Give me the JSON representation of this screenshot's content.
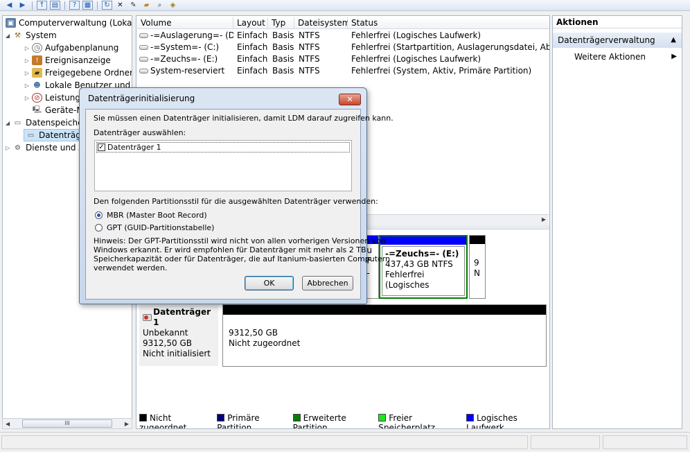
{
  "toolbar": {
    "icons": [
      "back-icon",
      "forward-icon",
      "up-folder-icon",
      "show-hide-tree-icon",
      "help-icon",
      "properties-icon",
      "refresh-icon",
      "delete-icon",
      "properties-sheet-icon",
      "open-icon",
      "search-icon",
      "rescan-icon"
    ]
  },
  "tree": {
    "items": [
      {
        "label": "Computerverwaltung (Lokal)"
      },
      {
        "label": "System"
      },
      {
        "label": "Aufgabenplanung"
      },
      {
        "label": "Ereignisanzeige"
      },
      {
        "label": "Freigegebene Ordner"
      },
      {
        "label": "Lokale Benutzer und Gr"
      },
      {
        "label": "Leistung"
      },
      {
        "label": "Geräte-M"
      },
      {
        "label": "Datenspeiche"
      },
      {
        "label": "Datenträg"
      },
      {
        "label": "Dienste und A"
      }
    ],
    "scroll_thumb": "III"
  },
  "volumes": {
    "columns": [
      "Volume",
      "Layout",
      "Typ",
      "Dateisystem",
      "Status"
    ],
    "rows": [
      {
        "volume": "-=Auslagerung=- (D:)",
        "layout": "Einfach",
        "typ": "Basis",
        "fs": "NTFS",
        "status": "Fehlerfrei (Logisches Laufwerk)"
      },
      {
        "volume": "-=System=- (C:)",
        "layout": "Einfach",
        "typ": "Basis",
        "fs": "NTFS",
        "status": "Fehlerfrei (Startpartition, Auslagerungsdatei, Absturzab"
      },
      {
        "volume": "-=Zeuchs=- (E:)",
        "layout": "Einfach",
        "typ": "Basis",
        "fs": "NTFS",
        "status": "Fehlerfrei (Logisches Laufwerk)"
      },
      {
        "volume": "System-reserviert",
        "layout": "Einfach",
        "typ": "Basis",
        "fs": "NTFS",
        "status": "Fehlerfrei (System, Aktiv, Primäre Partition)"
      }
    ]
  },
  "disk0": {
    "part_a": {
      "lines": [
        "eu",
        "TF",
        "(L"
      ]
    },
    "part_e": {
      "name": "-=Zeuchs=-  (E:)",
      "size": "437,43 GB NTFS",
      "status": "Fehlerfrei (Logisches"
    },
    "part_last": {
      "lines": [
        "9",
        "N"
      ]
    }
  },
  "disk1": {
    "name": "Datenträger 1",
    "type": "Unbekannt",
    "size": "9312,50 GB",
    "state": "Nicht initialisiert",
    "unalloc_size": "9312,50 GB",
    "unalloc_label": "Nicht zugeordnet"
  },
  "legend": [
    {
      "label": "Nicht zugeordnet",
      "color": "#000000"
    },
    {
      "label": "Primäre Partition",
      "color": "#00007b"
    },
    {
      "label": "Erweiterte Partition",
      "color": "#008000"
    },
    {
      "label": "Freier Speicherplatz",
      "color": "#1ee61e"
    },
    {
      "label": "Logisches Laufwerk",
      "color": "#0000ff"
    }
  ],
  "actions": {
    "title": "Aktionen",
    "section": "Datenträgerverwaltung",
    "more": "Weitere Aktionen"
  },
  "dialog": {
    "title": "Datenträgerinitialisierung",
    "close": "✕",
    "intro": "Sie müssen einen Datenträger initialisieren, damit LDM darauf zugreifen kann.",
    "select_label": "Datenträger auswählen:",
    "disk_item": "Datenträger 1",
    "disk_checked": true,
    "style_label": "Den folgenden Partitionsstil für die ausgewählten Datenträger verwenden:",
    "option_mbr": "MBR (Master Boot Record)",
    "option_gpt": "GPT (GUID-Partitionstabelle)",
    "selected_option": "MBR",
    "hint_lines": [
      "Hinweis: Der GPT-Partitionsstil wird nicht von allen vorherigen Versionen von",
      "Windows erkannt. Er wird empfohlen für Datenträger mit mehr als 2 TB",
      "Speicherkapazität oder für Datenträger, die auf Itanium-basierten Computern",
      "verwendet werden."
    ],
    "ok": "OK",
    "cancel": "Abbrechen"
  }
}
